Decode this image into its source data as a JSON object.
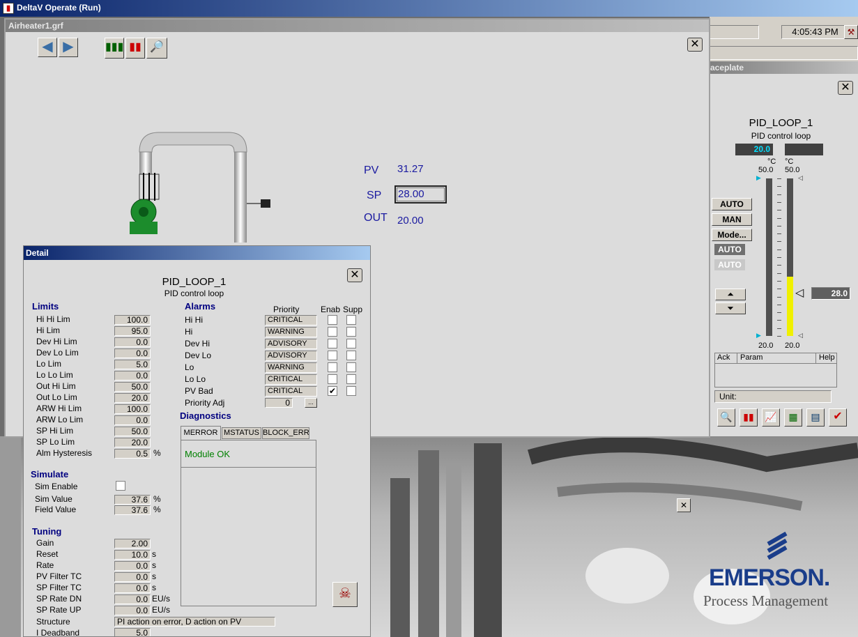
{
  "app": {
    "title": "DeltaV Operate (Run)"
  },
  "statusbar": {
    "time": "4:05:43 PM"
  },
  "graphic_window": {
    "title": "Airheater1.grf",
    "pv_label": "PV",
    "pv_value": "31.27",
    "sp_label": "SP",
    "sp_value": "28.00",
    "out_label": "OUT",
    "out_value": "20.00"
  },
  "faceplate": {
    "title": "aceplate",
    "tag": "PID_LOOP_1",
    "desc": "PID control loop",
    "pv_box": "20.0",
    "unit_left": "°C",
    "unit_right": "°C",
    "hi_left": "50.0",
    "hi_right": "50.0",
    "lo_left": "20.0",
    "lo_right": "20.0",
    "sp_box": "28.0",
    "auto_btn": "AUTO",
    "man_btn": "MAN",
    "mode_btn": "Mode...",
    "actual_mode": "AUTO",
    "target_mode": "AUTO",
    "col_ack": "Ack",
    "col_param": "Param",
    "col_help": "Help",
    "unit_label": "Unit:",
    "pv_level": 0.0,
    "out_level": 0.0,
    "sp_level": 0.267
  },
  "detail": {
    "title": "Detail",
    "tag": "PID_LOOP_1",
    "desc": "PID control loop",
    "limits_hdr": "Limits",
    "limits": [
      {
        "label": "Hi Hi Lim",
        "value": "100.0"
      },
      {
        "label": "Hi Lim",
        "value": "95.0"
      },
      {
        "label": "Dev Hi Lim",
        "value": "0.0"
      },
      {
        "label": "Dev Lo Lim",
        "value": "0.0"
      },
      {
        "label": "Lo Lim",
        "value": "5.0"
      },
      {
        "label": "Lo Lo Lim",
        "value": "0.0"
      },
      {
        "label": "Out Hi Lim",
        "value": "50.0"
      },
      {
        "label": "Out Lo Lim",
        "value": "20.0"
      },
      {
        "label": "ARW Hi Lim",
        "value": "100.0"
      },
      {
        "label": "ARW Lo Lim",
        "value": "0.0"
      },
      {
        "label": "SP Hi Lim",
        "value": "50.0"
      },
      {
        "label": "SP Lo Lim",
        "value": "20.0"
      },
      {
        "label": "Alm Hysteresis",
        "value": "0.5",
        "unit": "%"
      }
    ],
    "simulate_hdr": "Simulate",
    "sim_enable": "Sim Enable",
    "sim_value_label": "Sim Value",
    "sim_value": "37.6",
    "sim_unit": "%",
    "field_value_label": "Field Value",
    "field_value": "37.6",
    "field_unit": "%",
    "tuning_hdr": "Tuning",
    "tuning": [
      {
        "label": "Gain",
        "value": "2.00",
        "unit": ""
      },
      {
        "label": "Reset",
        "value": "10.0",
        "unit": "s"
      },
      {
        "label": "Rate",
        "value": "0.0",
        "unit": "s"
      },
      {
        "label": "PV Filter TC",
        "value": "0.0",
        "unit": "s"
      },
      {
        "label": "SP Filter TC",
        "value": "0.0",
        "unit": "s"
      },
      {
        "label": "SP Rate DN",
        "value": "0.0",
        "unit": "EU/s"
      },
      {
        "label": "SP Rate UP",
        "value": "0.0",
        "unit": "EU/s"
      }
    ],
    "structure_label": "Structure",
    "structure_value": "PI action on error, D action on PV",
    "deadband_label": "I Deadband",
    "deadband_value": "5.0",
    "alarms_hdr": "Alarms",
    "priority_hdr": "Priority",
    "enab_hdr": "Enab",
    "supp_hdr": "Supp",
    "alarms": [
      {
        "label": "Hi Hi",
        "priority": "CRITICAL"
      },
      {
        "label": "Hi",
        "priority": "WARNING"
      },
      {
        "label": "Dev Hi",
        "priority": "ADVISORY"
      },
      {
        "label": "Dev Lo",
        "priority": "ADVISORY"
      },
      {
        "label": "Lo",
        "priority": "WARNING"
      },
      {
        "label": "Lo Lo",
        "priority": "CRITICAL"
      },
      {
        "label": "PV Bad",
        "priority": "CRITICAL"
      }
    ],
    "check_mark": "✔",
    "priority_adj_label": "Priority Adj",
    "priority_adj_value": "0",
    "ellipsis": "...",
    "diag_hdr": "Diagnostics",
    "tabs": [
      "MERROR",
      "MSTATUS",
      "BLOCK_ERR"
    ],
    "diag_msg": "Module OK"
  },
  "emerson": {
    "brand": "EMERSON.",
    "sub": "Process Management"
  },
  "colors": {
    "accent": "#0a246a",
    "sp_bar": "#f0f000",
    "pv_box": "#00e0ff"
  }
}
